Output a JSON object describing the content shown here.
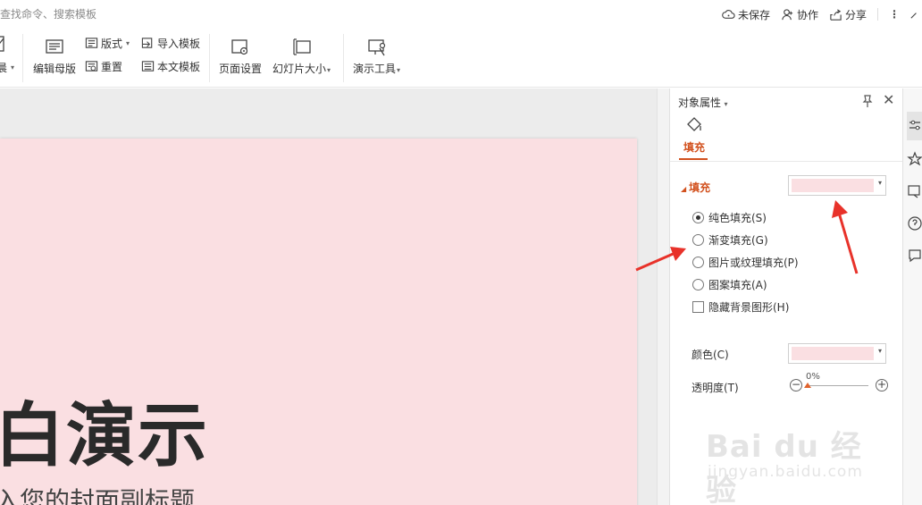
{
  "topbar": {
    "search_hint": "查找命令、搜索模板",
    "unsaved_label": "未保存",
    "collab_label": "协作",
    "share_label": "分享"
  },
  "ribbon": {
    "partial_left_label": "晨",
    "edit_master_label": "编辑母版",
    "layout_label": "版式",
    "reset_label": "重置",
    "import_template_label": "导入模板",
    "text_template_label": "本文模板",
    "page_setup_label": "页面设置",
    "slide_size_label": "幻灯片大小",
    "present_tools_label": "演示工具"
  },
  "slide": {
    "title": "白演示",
    "subtitle": "入您的封面副标题",
    "background": "#fadfe2"
  },
  "panel": {
    "title": "对象属性",
    "fill_tab_label": "填充",
    "fill_section_label": "填充",
    "options": [
      {
        "label": "纯色填充(S)",
        "checked": true
      },
      {
        "label": "渐变填充(G)",
        "checked": false
      },
      {
        "label": "图片或纹理填充(P)",
        "checked": false
      },
      {
        "label": "图案填充(A)",
        "checked": false
      }
    ],
    "hide_bg_label": "隐藏背景图形(H)",
    "color_label": "颜色(C)",
    "transparency_label": "透明度(T)",
    "transparency_value": "0%",
    "accent_color": "#d2511e",
    "fill_color": "#fadfe2"
  },
  "watermark": {
    "logo": "Bai du 经验",
    "sub": "jingyan.baidu.com"
  }
}
